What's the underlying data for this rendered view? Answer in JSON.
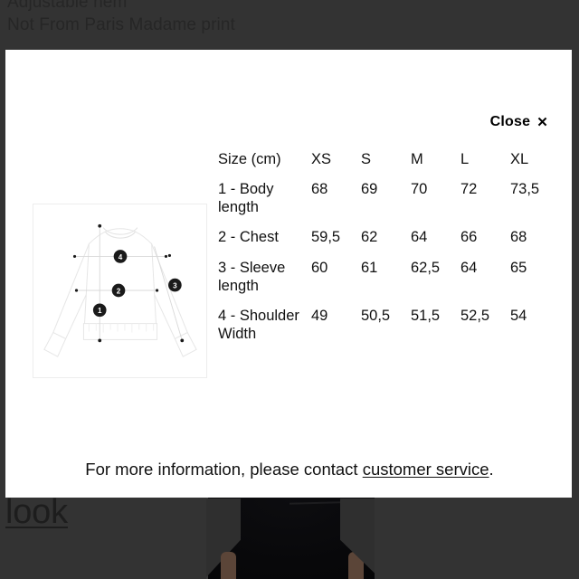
{
  "background": {
    "product_details": [
      "Adjustable hem",
      "Not From Paris Madame print"
    ],
    "look_link": "look",
    "bg_color": "#333333",
    "photo_alt": "black t-shirt product photo"
  },
  "modal": {
    "close_label": "Close",
    "close_icon": "close-x-icon",
    "diagram": {
      "alt": "sweatshirt technical drawing with measurement points",
      "markers": [
        {
          "id": "1",
          "meaning": "Body length"
        },
        {
          "id": "2",
          "meaning": "Chest"
        },
        {
          "id": "3",
          "meaning": "Sleeve length"
        },
        {
          "id": "4",
          "meaning": "Shoulder Width"
        }
      ]
    },
    "size_table": {
      "headers": [
        "Size (cm)",
        "XS",
        "S",
        "M",
        "L",
        "XL"
      ],
      "rows": [
        {
          "label": "1 - Body length",
          "values": [
            "68",
            "69",
            "70",
            "72",
            "73,5"
          ]
        },
        {
          "label": "2 - Chest",
          "values": [
            "59,5",
            "62",
            "64",
            "66",
            "68"
          ]
        },
        {
          "label": "3 - Sleeve length",
          "values": [
            "60",
            "61",
            "62,5",
            "64",
            "65"
          ]
        },
        {
          "label": "4 - Shoulder Width",
          "values": [
            "49",
            "50,5",
            "51,5",
            "52,5",
            "54"
          ]
        }
      ]
    },
    "note": {
      "prefix": "For more information, please contact ",
      "link": "customer service",
      "suffix": "."
    }
  }
}
